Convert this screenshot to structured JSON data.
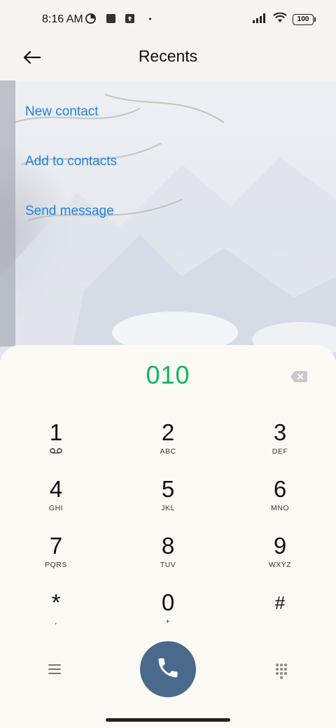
{
  "status_bar": {
    "time": "8:16 AM",
    "battery": "100",
    "icons_left": [
      "data-saver-icon",
      "square-app-icon",
      "upload-icon",
      "dot-icon"
    ],
    "icons_right": [
      "signal-icon",
      "wifi-icon",
      "battery-icon"
    ]
  },
  "header": {
    "title": "Recents",
    "back_icon": "arrow-left-icon"
  },
  "actions": [
    {
      "label": "New contact"
    },
    {
      "label": "Add to contacts"
    },
    {
      "label": "Send message"
    }
  ],
  "dialer": {
    "number": "010",
    "backspace_icon": "backspace-icon",
    "keys": [
      {
        "digit": "1",
        "letters": "",
        "extra_icon": "voicemail-icon"
      },
      {
        "digit": "2",
        "letters": "ABC"
      },
      {
        "digit": "3",
        "letters": "DEF"
      },
      {
        "digit": "4",
        "letters": "GHI"
      },
      {
        "digit": "5",
        "letters": "JKL"
      },
      {
        "digit": "6",
        "letters": "MNO"
      },
      {
        "digit": "7",
        "letters": "PQRS"
      },
      {
        "digit": "8",
        "letters": "TUV"
      },
      {
        "digit": "9",
        "letters": "WXYZ"
      },
      {
        "digit": "*",
        "letters": ","
      },
      {
        "digit": "0",
        "letters": "+"
      },
      {
        "digit": "#",
        "letters": ""
      }
    ],
    "bottom": {
      "menu_icon": "menu-icon",
      "call_icon": "phone-icon",
      "keypad_icon": "dialpad-icon"
    }
  },
  "colors": {
    "accent_link": "#1f82e0",
    "number_green": "#11b560",
    "call_button": "#4a6a8b",
    "panel_bg": "#fcfaf5"
  }
}
